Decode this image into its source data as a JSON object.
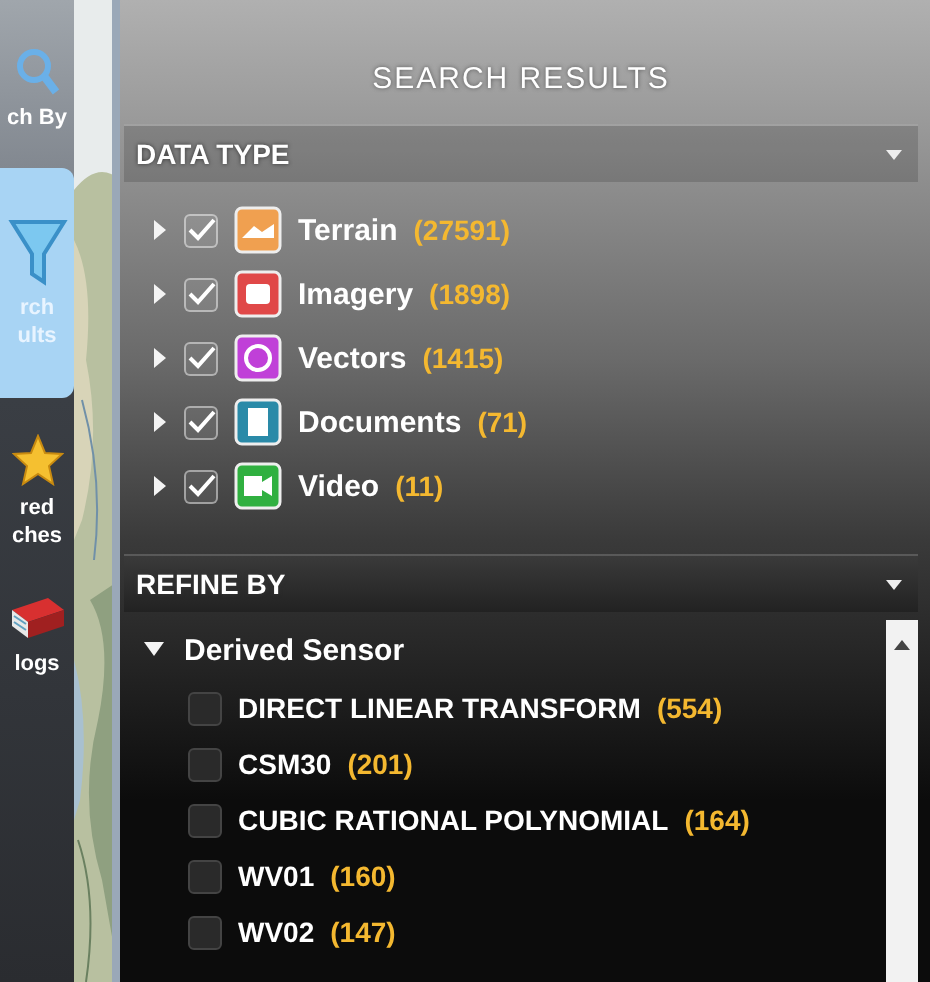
{
  "sidebar": {
    "items": [
      {
        "kind": "search",
        "label": "ch By",
        "selected": false
      },
      {
        "kind": "results",
        "label": "rch\nults",
        "selected": true
      },
      {
        "kind": "star",
        "label": "red\nches",
        "selected": false
      },
      {
        "kind": "catalog",
        "label": "logs",
        "selected": false
      }
    ]
  },
  "title": "SEARCH RESULTS",
  "data_type": {
    "title": "DATA TYPE",
    "items": [
      {
        "kind": "terrain",
        "label": "Terrain",
        "count": "(27591)",
        "checked": true,
        "expanded": false
      },
      {
        "kind": "imagery",
        "label": "Imagery",
        "count": "(1898)",
        "checked": true,
        "expanded": false
      },
      {
        "kind": "vectors",
        "label": "Vectors",
        "count": "(1415)",
        "checked": true,
        "expanded": false
      },
      {
        "kind": "documents",
        "label": "Documents",
        "count": "(71)",
        "checked": true,
        "expanded": false
      },
      {
        "kind": "video",
        "label": "Video",
        "count": "(11)",
        "checked": true,
        "expanded": false
      }
    ]
  },
  "refine_by": {
    "title": "REFINE BY",
    "group": {
      "label": "Derived Sensor",
      "expanded": true,
      "items": [
        {
          "label": "DIRECT LINEAR TRANSFORM",
          "count": "(554)",
          "checked": false
        },
        {
          "label": "CSM30",
          "count": "(201)",
          "checked": false
        },
        {
          "label": "CUBIC RATIONAL POLYNOMIAL",
          "count": "(164)",
          "checked": false
        },
        {
          "label": "WV01",
          "count": "(160)",
          "checked": false
        },
        {
          "label": "WV02",
          "count": "(147)",
          "checked": false
        }
      ]
    }
  }
}
